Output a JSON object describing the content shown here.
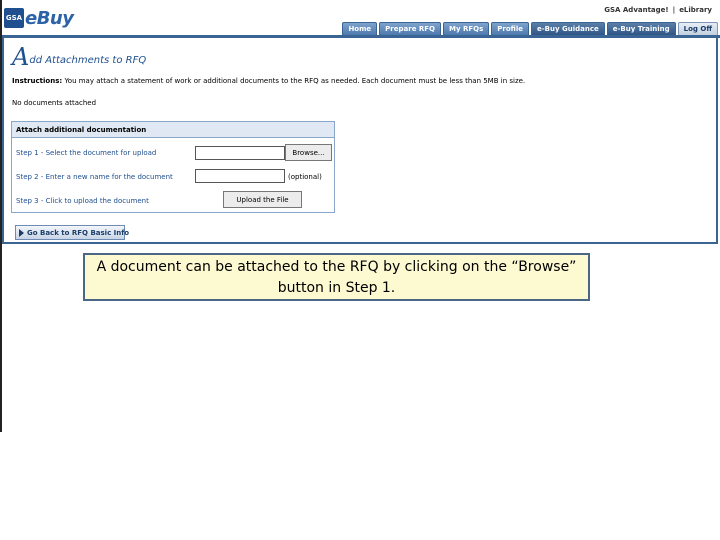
{
  "header": {
    "logo_gsa": "GSA",
    "logo_ebuy": "eBuy",
    "toplinks": [
      "GSA Advantage!",
      "eLibrary"
    ]
  },
  "tabs": [
    "Home",
    "Prepare RFQ",
    "My RFQs",
    "Profile",
    "e-Buy Guidance",
    "e-Buy Training",
    "Log Off"
  ],
  "page": {
    "title_initial": "A",
    "title_rest": "dd Attachments to RFQ",
    "instructions_label": "Instructions:",
    "instructions_text": "You may attach a statement of work or additional documents to the RFQ as needed. Each document must be less than 5MB in size.",
    "no_docs": "No documents attached"
  },
  "attach": {
    "heading": "Attach additional documentation",
    "step1": "Step 1 - Select the document for upload",
    "step2": "Step 2 - Enter a new name for the document",
    "step3": "Step 3 - Click to upload the document",
    "file_value": "",
    "name_value": "",
    "browse_label": "Browse...",
    "optional_label": "(optional)",
    "upload_label": "Upload the File"
  },
  "back_button": "Go Back to RFQ Basic Info",
  "callout": "A document can be attached to the RFQ by clicking on the “Browse” button in Step 1."
}
